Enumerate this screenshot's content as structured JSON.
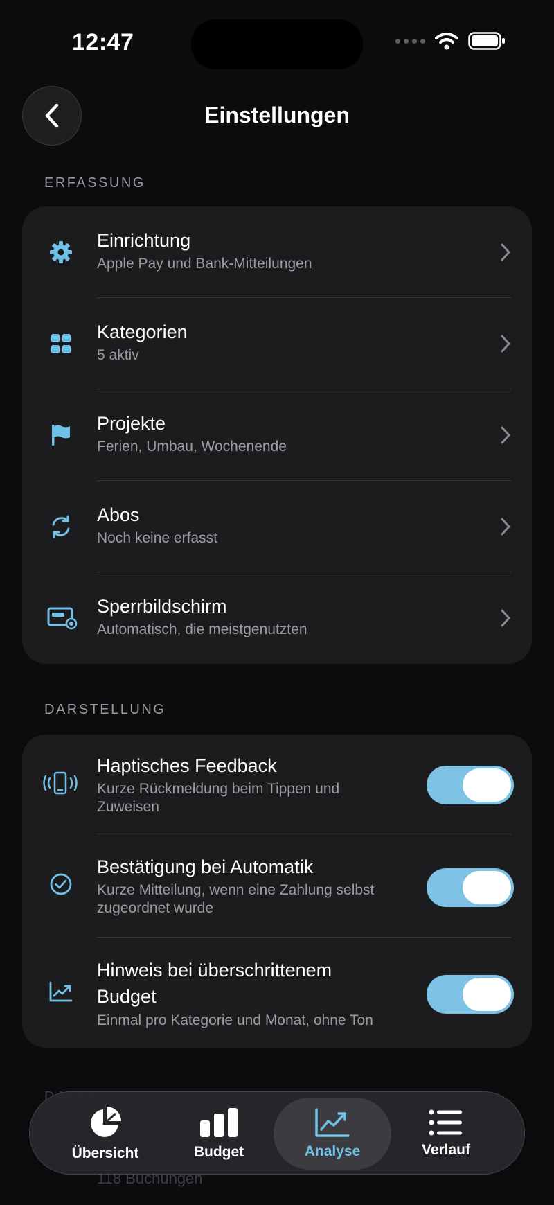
{
  "status_bar": {
    "time": "12:47"
  },
  "header": {
    "title": "Einstellungen"
  },
  "sections": {
    "erfassung": {
      "label": "ERFASSUNG",
      "items": [
        {
          "title": "Einrichtung",
          "subtitle": "Apple Pay und Bank-Mitteilungen",
          "icon": "gear-icon"
        },
        {
          "title": "Kategorien",
          "subtitle": "5 aktiv",
          "icon": "grid-icon"
        },
        {
          "title": "Projekte",
          "subtitle": "Ferien, Umbau, Wochenende",
          "icon": "flag-icon"
        },
        {
          "title": "Abos",
          "subtitle": "Noch keine erfasst",
          "icon": "refresh-icon"
        },
        {
          "title": "Sperrbildschirm",
          "subtitle": "Automatisch, die meistgenutzten",
          "icon": "lockscreen-icon"
        }
      ]
    },
    "darstellung": {
      "label": "DARSTELLUNG",
      "items": [
        {
          "title": "Haptisches Feedback",
          "subtitle_line1": "Kurze Rückmeldung beim Tippen und",
          "subtitle_line2": "Zuweisen",
          "toggle_on": true,
          "icon": "phone-vibrate-icon"
        },
        {
          "title": "Bestätigung bei Automatik",
          "subtitle_line1": "Kurze Mitteilung, wenn eine Zahlung selbst",
          "subtitle_line2": "zugeordnet wurde",
          "toggle_on": true,
          "icon": "check-circle-icon"
        },
        {
          "title_line1": "Hinweis bei überschrittenem",
          "title_line2": "Budget",
          "subtitle": "Einmal pro Kategorie und Monat, ohne Ton",
          "toggle_on": true,
          "icon": "trend-up-icon"
        }
      ]
    }
  },
  "partial": {
    "section_label": "DATEN",
    "item_subtitle": "118 Buchungen"
  },
  "tabbar": {
    "tabs": [
      {
        "label": "Übersicht",
        "icon": "pie-chart-icon",
        "active": false
      },
      {
        "label": "Budget",
        "icon": "bar-chart-icon",
        "active": false
      },
      {
        "label": "Analyse",
        "icon": "line-chart-icon",
        "active": true
      },
      {
        "label": "Verlauf",
        "icon": "list-icon",
        "active": false
      }
    ]
  },
  "colors": {
    "accent": "#6fc1e8",
    "toggle_on": "#7ec3e6",
    "background": "#0c0c0e",
    "card": "#1c1c1f"
  }
}
